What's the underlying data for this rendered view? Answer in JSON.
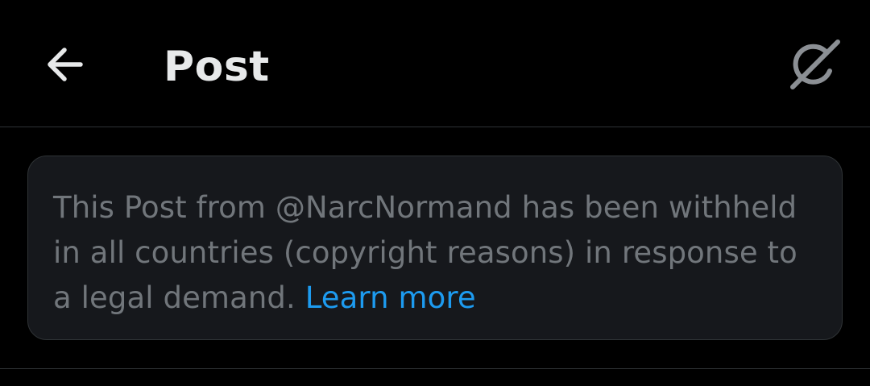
{
  "header": {
    "title": "Post",
    "back_icon": "arrow-left-icon",
    "grok_icon": "grok-icon"
  },
  "notice": {
    "text": "This Post from @NarcNormand has been withheld in all countries (copyright reasons) in response to a legal demand.",
    "link_label": "Learn more"
  },
  "colors": {
    "background": "#000000",
    "card_background": "#16181c",
    "divider": "#2f3336",
    "text_primary": "#e7e9ea",
    "text_secondary": "#71767b",
    "link": "#1d9bf0"
  }
}
